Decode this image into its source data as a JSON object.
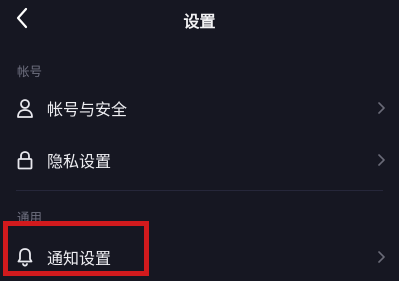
{
  "header": {
    "title": "设置",
    "back_icon": "chevron-left-icon"
  },
  "sections": [
    {
      "label": "帐号",
      "items": [
        {
          "label": "帐号与安全",
          "icon": "user-icon"
        },
        {
          "label": "隐私设置",
          "icon": "lock-icon"
        }
      ]
    },
    {
      "label": "通用",
      "items": [
        {
          "label": "通知设置",
          "icon": "bell-icon"
        }
      ]
    }
  ],
  "highlight_color": "#d11a1d"
}
